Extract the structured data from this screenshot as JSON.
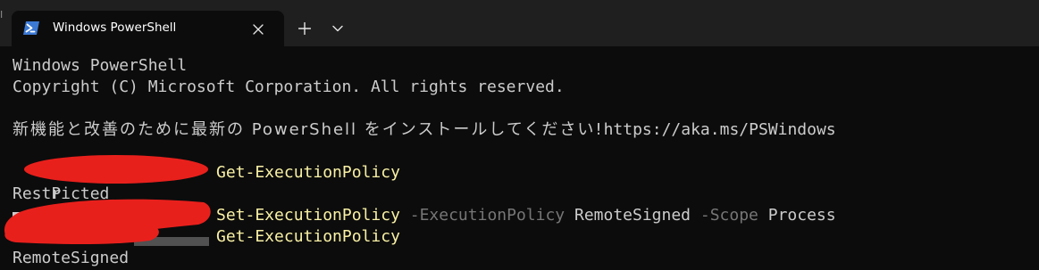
{
  "window": {
    "edge_glyph": "I"
  },
  "tab": {
    "title": "Windows PowerShell",
    "icon": "powershell-icon",
    "close_glyph": "✕"
  },
  "tabstrip": {
    "new_tab_glyph": "+",
    "dropdown_icon": "chevron-down-icon"
  },
  "terminal": {
    "banner_1": "Windows PowerShell",
    "banner_2": "Copyright (C) Microsoft Corporation. All rights reserved.",
    "install_notice_jp": "新機能と改善のために最新の PowerShell をインストールしてください!",
    "install_notice_url": "https://aka.ms/PSWindows",
    "lines": [
      {
        "prompt_visible": "P",
        "command": "Get-ExecutionPolicy",
        "rest": []
      },
      {
        "output": "Restricted"
      },
      {
        "prompt_visible": "",
        "command": "Set-ExecutionPolicy",
        "rest": [
          {
            "kind": "param",
            "text": " -ExecutionPolicy"
          },
          {
            "kind": "arg",
            "text": " RemoteSigned"
          },
          {
            "kind": "param",
            "text": " -Scope"
          },
          {
            "kind": "arg",
            "text": " Process"
          }
        ]
      },
      {
        "prompt_visible": "",
        "command": "Get-ExecutionPolicy",
        "rest": []
      },
      {
        "output": "RemoteSigned"
      }
    ]
  },
  "colors": {
    "background": "#0c0c0c",
    "tabstrip": "#1f1f1f",
    "text": "#cccccc",
    "command": "#f9f1a5",
    "parameter": "#767676",
    "redaction": "#e8201c",
    "powershell_icon": "#3c79d4"
  }
}
